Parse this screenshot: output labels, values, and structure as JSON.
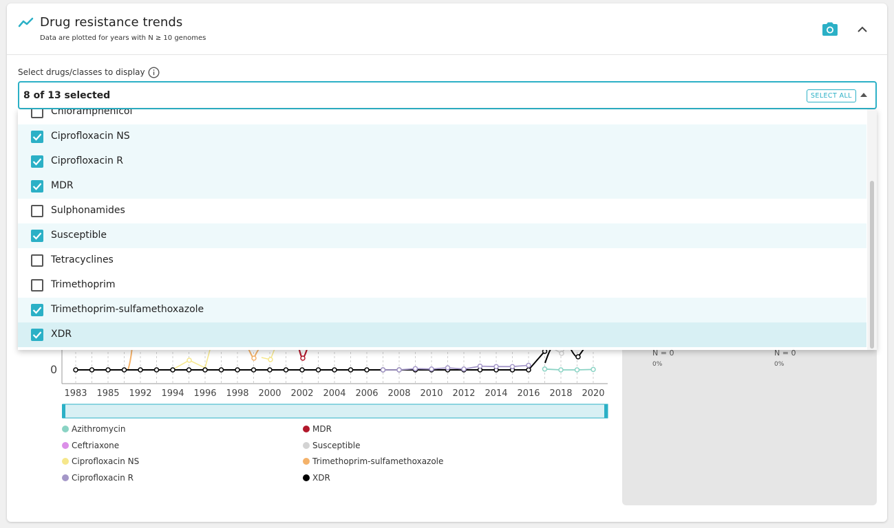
{
  "header": {
    "title": "Drug resistance trends",
    "subtitle": "Data are plotted for years with N ≥ 10 genomes",
    "accent_color": "#2bb0c6",
    "icons": [
      "trend-line-icon",
      "camera-icon",
      "chevron-up-icon"
    ]
  },
  "selector": {
    "label": "Select drugs/classes to display",
    "value": "8 of 13 selected",
    "select_all_label": "SELECT ALL",
    "icons": [
      "info-icon",
      "caret-up-icon"
    ]
  },
  "dropdown": {
    "items": [
      {
        "label": "Chloramphenicol",
        "checked": false
      },
      {
        "label": "Ciprofloxacin NS",
        "checked": true
      },
      {
        "label": "Ciprofloxacin R",
        "checked": true
      },
      {
        "label": "MDR",
        "checked": true
      },
      {
        "label": "Sulphonamides",
        "checked": false
      },
      {
        "label": "Susceptible",
        "checked": true
      },
      {
        "label": "Tetracyclines",
        "checked": false
      },
      {
        "label": "Trimethoprim",
        "checked": false
      },
      {
        "label": "Trimethoprim-sulfamethoxazole",
        "checked": true
      },
      {
        "label": "XDR",
        "checked": true
      }
    ]
  },
  "chart_data": {
    "type": "line",
    "y_visible_tick": "0",
    "x_tick_labels": [
      "1983",
      "1985",
      "1992",
      "1994",
      "1996",
      "1998",
      "2000",
      "2002",
      "2004",
      "2006",
      "2008",
      "2010",
      "2012",
      "2014",
      "2016",
      "2018",
      "2020"
    ],
    "categories": [
      "1983",
      "1984",
      "1985",
      "1990",
      "1992",
      "1993",
      "1994",
      "1995",
      "1996",
      "1997",
      "1998",
      "1999",
      "2000",
      "2001",
      "2002",
      "2003",
      "2004",
      "2005",
      "2006",
      "2007",
      "2008",
      "2009",
      "2010",
      "2011",
      "2012",
      "2013",
      "2014",
      "2015",
      "2016",
      "2017",
      "2018",
      "2019",
      "2020"
    ],
    "series": [
      {
        "name": "XDR",
        "color": "#000000",
        "values": [
          0,
          0,
          0,
          0,
          0,
          0,
          0,
          0,
          0,
          0,
          0,
          0,
          0,
          0,
          0,
          0,
          0,
          0,
          0,
          0,
          0,
          0,
          0,
          0,
          0,
          0,
          0,
          0,
          0,
          4.5,
          null,
          null,
          null
        ]
      },
      {
        "name": "Ciprofloxacin R",
        "color": "#a497c8",
        "values": [
          null,
          null,
          null,
          null,
          null,
          null,
          null,
          null,
          null,
          null,
          null,
          null,
          null,
          null,
          null,
          null,
          null,
          null,
          null,
          0,
          0,
          0.3,
          0.2,
          0.5,
          0.2,
          0.9,
          0.8,
          0.8,
          1.1,
          null,
          null,
          null,
          null
        ]
      },
      {
        "name": "Azithromycin",
        "color": "#8ad3c4",
        "values": [
          null,
          null,
          null,
          null,
          null,
          null,
          null,
          null,
          null,
          null,
          null,
          null,
          null,
          null,
          null,
          null,
          null,
          null,
          null,
          null,
          null,
          null,
          null,
          null,
          null,
          null,
          null,
          null,
          null,
          0.2,
          0,
          0,
          0.1
        ]
      }
    ]
  },
  "legend": [
    {
      "label": "Azithromycin",
      "color": "#8ad3c4"
    },
    {
      "label": "Ceftriaxone",
      "color": "#db8fe8"
    },
    {
      "label": "Ciprofloxacin NS",
      "color": "#f6e78b"
    },
    {
      "label": "Ciprofloxacin R",
      "color": "#a497c8"
    },
    {
      "label": "MDR",
      "color": "#b2182b"
    },
    {
      "label": "Susceptible",
      "color": "#d3d3d3"
    },
    {
      "label": "Trimethoprim-sulfamethoxazole",
      "color": "#f4b26a"
    },
    {
      "label": "XDR",
      "color": "#000000"
    }
  ],
  "right_panel": {
    "n1": "N = 0",
    "p1": "0%",
    "n2": "N = 0",
    "p2": "0%"
  }
}
